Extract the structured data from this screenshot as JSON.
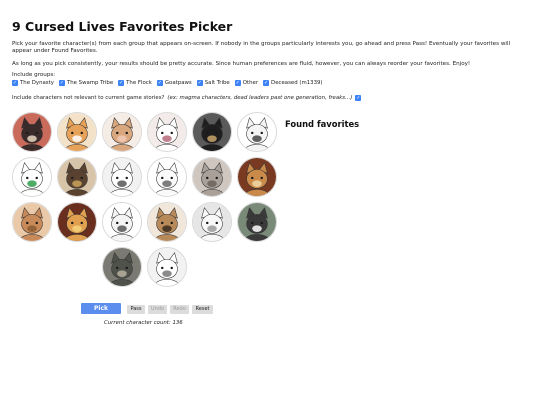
{
  "title": "9 Cursed Lives Favorites Picker",
  "intro": "Pick your favorite character(s) from each group that appears on-screen. If nobody in the groups particularly interests you, go ahead and press Pass! Eventually your favorites will appear under Found Favorites.",
  "consistency_note": "As long as you pick consistently, your results should be pretty accurate. Since human preferences are fluid, however, you can always reorder your favorites. Enjoy!",
  "include_groups_label": "Include groups:",
  "groups": [
    {
      "label": "The Dynasty",
      "checked": true
    },
    {
      "label": "The Swamp Tribe",
      "checked": true
    },
    {
      "label": "The Flock",
      "checked": true
    },
    {
      "label": "Goatpaws",
      "checked": true
    },
    {
      "label": "Salt Tribe",
      "checked": true
    },
    {
      "label": "Other",
      "checked": true
    },
    {
      "label": "Deceased (m1339)",
      "checked": true
    }
  ],
  "irrelevant_question": "Include characters not relevant to current game stories?",
  "irrelevant_examples": "(ex: magma characters, dead leaders past one generation, freaks...)",
  "irrelevant_checked": true,
  "found_favorites_title": "Found favorites",
  "buttons": {
    "pick": "Pick",
    "pass": "Pass",
    "undo": "Undo",
    "redo": "Redo",
    "reset": "Reset"
  },
  "count_label": "Current character count: 136",
  "accent_color": "#5b8def",
  "portraits": [
    {
      "icon": "cat-portrait-icon",
      "bg": "#c96a5a",
      "fur": "#3a2a2a",
      "accent": "#e8d6c0"
    },
    {
      "icon": "cat-portrait-icon",
      "bg": "#f4e2c8",
      "fur": "#e7a25a",
      "accent": "#ffffff"
    },
    {
      "icon": "cat-portrait-icon",
      "bg": "#f5ece6",
      "fur": "#d9a77e",
      "accent": "#f0c9b5"
    },
    {
      "icon": "cat-portrait-icon",
      "bg": "#f3eaea",
      "fur": "#ffffff",
      "accent": "#b76a7a"
    },
    {
      "icon": "cat-portrait-icon",
      "bg": "#5a5a5a",
      "fur": "#1e1e1e",
      "accent": "#c8a66a"
    },
    {
      "icon": "cat-portrait-icon",
      "bg": "#ffffff",
      "fur": "#f4f4f4",
      "accent": "#444444"
    },
    {
      "icon": "cat-portrait-icon",
      "bg": "#ffffff",
      "fur": "#ffffff",
      "accent": "#2f9e4a"
    },
    {
      "icon": "cat-portrait-icon",
      "bg": "#d8c4a8",
      "fur": "#5a4230",
      "accent": "#c9a25c"
    },
    {
      "icon": "cat-portrait-icon",
      "bg": "#f2f2f2",
      "fur": "#ffffff",
      "accent": "#555555"
    },
    {
      "icon": "cat-portrait-icon",
      "bg": "#ffffff",
      "fur": "#fafafa",
      "accent": "#666666"
    },
    {
      "icon": "cat-portrait-icon",
      "bg": "#cfc6c0",
      "fur": "#a9a09a",
      "accent": "#6b625c"
    },
    {
      "icon": "cat-portrait-icon",
      "bg": "#7a3a22",
      "fur": "#c98a4a",
      "accent": "#f0d9a8"
    },
    {
      "icon": "cat-portrait-icon",
      "bg": "#e9c9a8",
      "fur": "#c98a5a",
      "accent": "#8a5a34"
    },
    {
      "icon": "cat-portrait-icon",
      "bg": "#6a2e1e",
      "fur": "#e0a050",
      "accent": "#f5d27a"
    },
    {
      "icon": "cat-portrait-icon",
      "bg": "#ffffff",
      "fur": "#f4f4f4",
      "accent": "#555555"
    },
    {
      "icon": "cat-portrait-icon",
      "bg": "#f0e6da",
      "fur": "#b88a5a",
      "accent": "#3a2a20"
    },
    {
      "icon": "cat-portrait-icon",
      "bg": "#e6e6e6",
      "fur": "#f8f8f8",
      "accent": "#9a9a9a"
    },
    {
      "icon": "cat-portrait-icon",
      "bg": "#7a8a78",
      "fur": "#3a3a3a",
      "accent": "#ffffff"
    },
    {
      "icon": "cat-portrait-icon",
      "bg": "#7a7a72",
      "fur": "#4e524a",
      "accent": "#b8b0a0"
    },
    {
      "icon": "cat-portrait-icon",
      "bg": "#f2f2f2",
      "fur": "#ffffff",
      "accent": "#777777"
    }
  ]
}
